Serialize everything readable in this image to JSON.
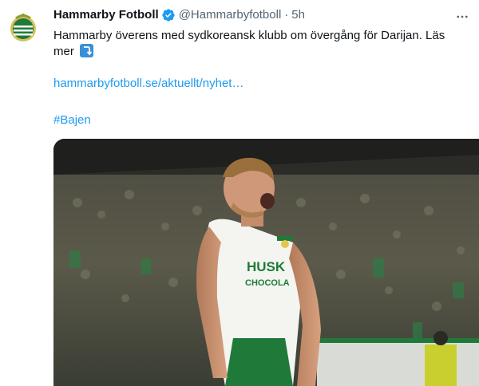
{
  "tweet": {
    "display_name": "Hammarby Fotboll",
    "handle": "@Hammarbyfotboll",
    "separator": "·",
    "timestamp": "5h",
    "text": "Hammarby överens med sydkoreansk klubb om övergång för Darijan. Läs mer",
    "link": "hammarbyfotboll.se/aktuellt/nyhet…",
    "hashtag": "#Bajen",
    "media_shirt_sponsor_line1": "HUSK",
    "media_shirt_sponsor_line2": "CHOCOLA"
  },
  "colors": {
    "link": "#1d9bf0",
    "verified": "#1d9bf0",
    "secondary_text": "#536471",
    "brand_green": "#1f7a3a"
  },
  "icons": {
    "verified": "verified-badge-icon",
    "more": "more-options-icon",
    "arrow": "arrow-right-hook-emoji"
  }
}
